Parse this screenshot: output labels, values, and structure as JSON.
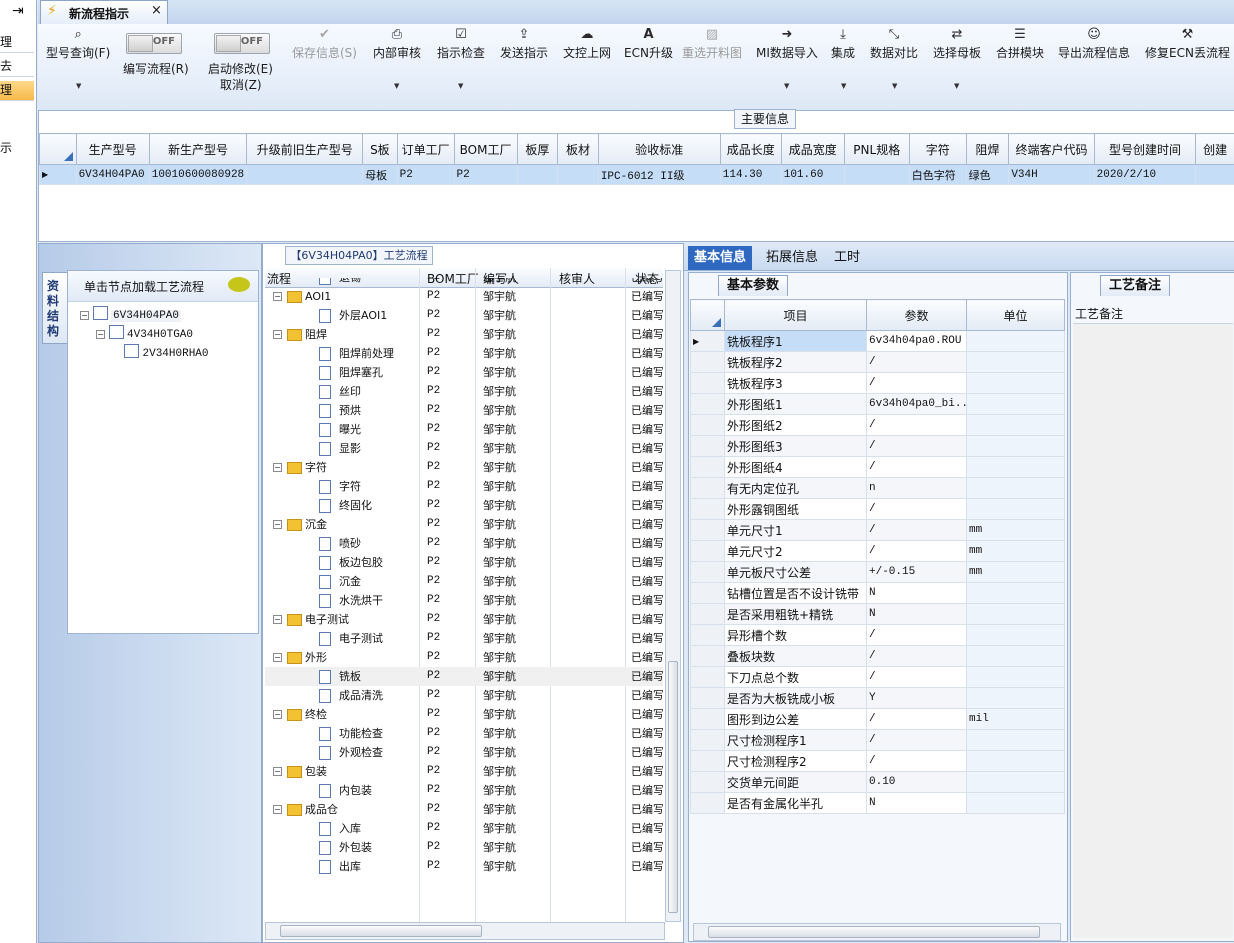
{
  "left_stub": {
    "items": [
      "理",
      "去",
      "理",
      "示"
    ]
  },
  "tab": {
    "title": "新流程指示",
    "close": "×"
  },
  "toolbar": {
    "buttons": [
      {
        "label": "型号查询(F)",
        "icon": "search-icon",
        "glyph": "🔍",
        "disabled": false,
        "dropdown": true
      },
      {
        "label": "保存信息(S)",
        "icon": "check-icon",
        "glyph": "✔",
        "disabled": true,
        "dropdown": false
      },
      {
        "label": "内部审核",
        "icon": "printer-icon",
        "glyph": "🖶",
        "disabled": false,
        "dropdown": true
      },
      {
        "label": "指示检查",
        "icon": "checkbox-icon",
        "glyph": "☑",
        "disabled": false,
        "dropdown": true
      },
      {
        "label": "发送指示",
        "icon": "upload-icon",
        "glyph": "⇪",
        "disabled": false,
        "dropdown": false
      },
      {
        "label": "文控上网",
        "icon": "cloud-upload-icon",
        "glyph": "☁",
        "disabled": false,
        "dropdown": false
      },
      {
        "label": "ECN升级",
        "icon": "font-icon",
        "glyph": "A",
        "disabled": false,
        "dropdown": false
      },
      {
        "label": "重选开料图",
        "icon": "image-icon",
        "glyph": "▨",
        "disabled": true,
        "dropdown": false
      },
      {
        "label": "MI数据导入",
        "icon": "import-icon",
        "glyph": "➔",
        "disabled": false,
        "dropdown": true
      },
      {
        "label": "集成",
        "icon": "download-icon",
        "glyph": "⤓",
        "disabled": false,
        "dropdown": true
      },
      {
        "label": "数据对比",
        "icon": "compress-icon",
        "glyph": "⤡",
        "disabled": false,
        "dropdown": true
      },
      {
        "label": "选择母板",
        "icon": "shuffle-icon",
        "glyph": "⇄",
        "disabled": false,
        "dropdown": true
      },
      {
        "label": "合拼模块",
        "icon": "list-icon",
        "glyph": "☰",
        "disabled": false,
        "dropdown": false
      },
      {
        "label": "导出流程信息",
        "icon": "smile-icon",
        "glyph": "☺",
        "disabled": false,
        "dropdown": false
      },
      {
        "label": "修复ECN丢流程",
        "icon": "wrench-icon",
        "glyph": "🔧",
        "disabled": false,
        "dropdown": false
      }
    ],
    "toggles": [
      {
        "label": "编写流程(R)",
        "state": "OFF"
      },
      {
        "label": "启动修改(E)",
        "label2": "取消(Z)",
        "state": "OFF"
      }
    ]
  },
  "main_info": {
    "title": "主要信息",
    "columns": [
      "生产型号",
      "新生产型号",
      "升级前旧生产型号",
      "S板",
      "订单工厂",
      "BOM工厂",
      "板厚",
      "板材",
      "验收标准",
      "成品长度",
      "成品宽度",
      "PNL规格",
      "字符",
      "阻焊",
      "终端客户代码",
      "型号创建时间",
      "创建"
    ],
    "row": [
      "6V34H04PA0",
      "10010600080928",
      "",
      "母板",
      "P2",
      "P2",
      "",
      "",
      "IPC-6012 II级",
      "114.30",
      "101.60",
      "",
      "白色字符",
      "绿色",
      "V34H",
      "2020/2/10",
      ""
    ]
  },
  "structure": {
    "vtab": "资料结构",
    "header": "单击节点加载工艺流程",
    "tree": [
      "6V34H04PA0",
      "4V34H0TGA0",
      "2V34H0RHA0"
    ]
  },
  "flow": {
    "title": "【6V34H04PA0】工艺流程",
    "columns": [
      "流程",
      "BOM工厂",
      "编写人",
      "核审人",
      "状态"
    ],
    "rows": [
      {
        "name": "退锡",
        "level": 2,
        "bom": "P2",
        "author": "邹宇航",
        "status": "已编写"
      },
      {
        "name": "AOI1",
        "level": 1,
        "bom": "P2",
        "author": "邹宇航",
        "status": "已编写"
      },
      {
        "name": "外层AOI1",
        "level": 2,
        "bom": "P2",
        "author": "邹宇航",
        "status": "已编写"
      },
      {
        "name": "阻焊",
        "level": 1,
        "bom": "P2",
        "author": "邹宇航",
        "status": "已编写"
      },
      {
        "name": "阻焊前处理",
        "level": 2,
        "bom": "P2",
        "author": "邹宇航",
        "status": "已编写"
      },
      {
        "name": "阻焊塞孔",
        "level": 2,
        "bom": "P2",
        "author": "邹宇航",
        "status": "已编写"
      },
      {
        "name": "丝印",
        "level": 2,
        "bom": "P2",
        "author": "邹宇航",
        "status": "已编写"
      },
      {
        "name": "预烘",
        "level": 2,
        "bom": "P2",
        "author": "邹宇航",
        "status": "已编写"
      },
      {
        "name": "曝光",
        "level": 2,
        "bom": "P2",
        "author": "邹宇航",
        "status": "已编写"
      },
      {
        "name": "显影",
        "level": 2,
        "bom": "P2",
        "author": "邹宇航",
        "status": "已编写"
      },
      {
        "name": "字符",
        "level": 1,
        "bom": "P2",
        "author": "邹宇航",
        "status": "已编写"
      },
      {
        "name": "字符",
        "level": 2,
        "bom": "P2",
        "author": "邹宇航",
        "status": "已编写"
      },
      {
        "name": "终固化",
        "level": 2,
        "bom": "P2",
        "author": "邹宇航",
        "status": "已编写"
      },
      {
        "name": "沉金",
        "level": 1,
        "bom": "P2",
        "author": "邹宇航",
        "status": "已编写"
      },
      {
        "name": "喷砂",
        "level": 2,
        "bom": "P2",
        "author": "邹宇航",
        "status": "已编写"
      },
      {
        "name": "板边包胶",
        "level": 2,
        "bom": "P2",
        "author": "邹宇航",
        "status": "已编写"
      },
      {
        "name": "沉金",
        "level": 2,
        "bom": "P2",
        "author": "邹宇航",
        "status": "已编写"
      },
      {
        "name": "水洗烘干",
        "level": 2,
        "bom": "P2",
        "author": "邹宇航",
        "status": "已编写"
      },
      {
        "name": "电子测试",
        "level": 1,
        "bom": "P2",
        "author": "邹宇航",
        "status": "已编写"
      },
      {
        "name": "电子测试",
        "level": 2,
        "bom": "P2",
        "author": "邹宇航",
        "status": "已编写"
      },
      {
        "name": "外形",
        "level": 1,
        "bom": "P2",
        "author": "邹宇航",
        "status": "已编写"
      },
      {
        "name": "铣板",
        "level": 2,
        "bom": "P2",
        "author": "邹宇航",
        "status": "已编写"
      },
      {
        "name": "成品清洗",
        "level": 2,
        "bom": "P2",
        "author": "邹宇航",
        "status": "已编写"
      },
      {
        "name": "终检",
        "level": 1,
        "bom": "P2",
        "author": "邹宇航",
        "status": "已编写"
      },
      {
        "name": "功能检查",
        "level": 2,
        "bom": "P2",
        "author": "邹宇航",
        "status": "已编写"
      },
      {
        "name": "外观检查",
        "level": 2,
        "bom": "P2",
        "author": "邹宇航",
        "status": "已编写"
      },
      {
        "name": "包装",
        "level": 1,
        "bom": "P2",
        "author": "邹宇航",
        "status": "已编写"
      },
      {
        "name": "内包装",
        "level": 2,
        "bom": "P2",
        "author": "邹宇航",
        "status": "已编写"
      },
      {
        "name": "成品仓",
        "level": 1,
        "bom": "P2",
        "author": "邹宇航",
        "status": "已编写"
      },
      {
        "name": "入库",
        "level": 2,
        "bom": "P2",
        "author": "邹宇航",
        "status": "已编写"
      },
      {
        "name": "外包装",
        "level": 2,
        "bom": "P2",
        "author": "邹宇航",
        "status": "已编写"
      },
      {
        "name": "出库",
        "level": 2,
        "bom": "P2",
        "author": "邹宇航",
        "status": "已编写"
      }
    ]
  },
  "right_tabs": [
    "基本信息",
    "拓展信息",
    "工时"
  ],
  "basic": {
    "subtab": "基本参数",
    "columns": [
      "项目",
      "参数",
      "单位"
    ],
    "rows": [
      [
        "铣板程序1",
        "6v34h04pa0.ROU",
        ""
      ],
      [
        "铣板程序2",
        "/",
        ""
      ],
      [
        "铣板程序3",
        "/",
        ""
      ],
      [
        "外形图纸1",
        "6v34h04pa0_bi...",
        ""
      ],
      [
        "外形图纸2",
        "/",
        ""
      ],
      [
        "外形图纸3",
        "/",
        ""
      ],
      [
        "外形图纸4",
        "/",
        ""
      ],
      [
        "有无内定位孔",
        "n",
        ""
      ],
      [
        "外形露铜图纸",
        "/",
        ""
      ],
      [
        "单元尺寸1",
        "/",
        "mm"
      ],
      [
        "单元尺寸2",
        "/",
        "mm"
      ],
      [
        "单元板尺寸公差",
        "+/-0.15",
        "mm"
      ],
      [
        "钻槽位置是否不设计铣带",
        "N",
        ""
      ],
      [
        "是否采用粗铣+精铣",
        "N",
        ""
      ],
      [
        "异形槽个数",
        "/",
        ""
      ],
      [
        "叠板块数",
        "/",
        ""
      ],
      [
        "下刀点总个数",
        "/",
        ""
      ],
      [
        "是否为大板铣成小板",
        "Y",
        ""
      ],
      [
        "图形到边公差",
        "/",
        "mil"
      ],
      [
        "尺寸检测程序1",
        "/",
        ""
      ],
      [
        "尺寸检测程序2",
        "/",
        ""
      ],
      [
        "交货单元间距",
        "0.10",
        ""
      ],
      [
        "是否有金属化半孔",
        "N",
        ""
      ]
    ]
  },
  "remarks": {
    "subtab": "工艺备注",
    "label": "工艺备注"
  }
}
